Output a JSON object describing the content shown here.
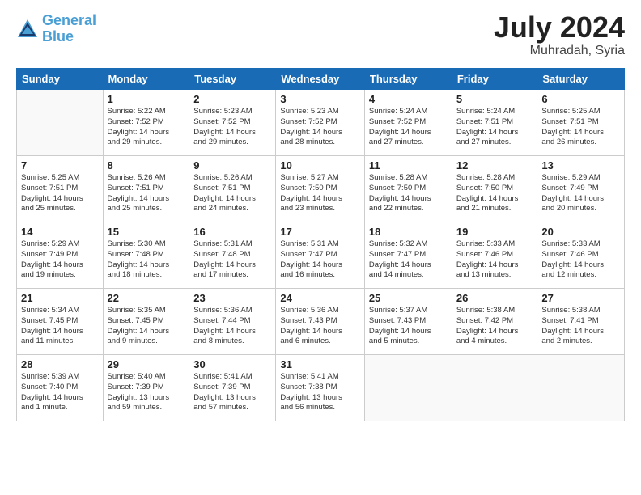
{
  "header": {
    "logo_line1": "General",
    "logo_line2": "Blue",
    "month": "July 2024",
    "location": "Muhradah, Syria"
  },
  "weekdays": [
    "Sunday",
    "Monday",
    "Tuesday",
    "Wednesday",
    "Thursday",
    "Friday",
    "Saturday"
  ],
  "weeks": [
    [
      {
        "day": "",
        "info": ""
      },
      {
        "day": "1",
        "info": "Sunrise: 5:22 AM\nSunset: 7:52 PM\nDaylight: 14 hours\nand 29 minutes."
      },
      {
        "day": "2",
        "info": "Sunrise: 5:23 AM\nSunset: 7:52 PM\nDaylight: 14 hours\nand 29 minutes."
      },
      {
        "day": "3",
        "info": "Sunrise: 5:23 AM\nSunset: 7:52 PM\nDaylight: 14 hours\nand 28 minutes."
      },
      {
        "day": "4",
        "info": "Sunrise: 5:24 AM\nSunset: 7:52 PM\nDaylight: 14 hours\nand 27 minutes."
      },
      {
        "day": "5",
        "info": "Sunrise: 5:24 AM\nSunset: 7:51 PM\nDaylight: 14 hours\nand 27 minutes."
      },
      {
        "day": "6",
        "info": "Sunrise: 5:25 AM\nSunset: 7:51 PM\nDaylight: 14 hours\nand 26 minutes."
      }
    ],
    [
      {
        "day": "7",
        "info": "Sunrise: 5:25 AM\nSunset: 7:51 PM\nDaylight: 14 hours\nand 25 minutes."
      },
      {
        "day": "8",
        "info": "Sunrise: 5:26 AM\nSunset: 7:51 PM\nDaylight: 14 hours\nand 25 minutes."
      },
      {
        "day": "9",
        "info": "Sunrise: 5:26 AM\nSunset: 7:51 PM\nDaylight: 14 hours\nand 24 minutes."
      },
      {
        "day": "10",
        "info": "Sunrise: 5:27 AM\nSunset: 7:50 PM\nDaylight: 14 hours\nand 23 minutes."
      },
      {
        "day": "11",
        "info": "Sunrise: 5:28 AM\nSunset: 7:50 PM\nDaylight: 14 hours\nand 22 minutes."
      },
      {
        "day": "12",
        "info": "Sunrise: 5:28 AM\nSunset: 7:50 PM\nDaylight: 14 hours\nand 21 minutes."
      },
      {
        "day": "13",
        "info": "Sunrise: 5:29 AM\nSunset: 7:49 PM\nDaylight: 14 hours\nand 20 minutes."
      }
    ],
    [
      {
        "day": "14",
        "info": "Sunrise: 5:29 AM\nSunset: 7:49 PM\nDaylight: 14 hours\nand 19 minutes."
      },
      {
        "day": "15",
        "info": "Sunrise: 5:30 AM\nSunset: 7:48 PM\nDaylight: 14 hours\nand 18 minutes."
      },
      {
        "day": "16",
        "info": "Sunrise: 5:31 AM\nSunset: 7:48 PM\nDaylight: 14 hours\nand 17 minutes."
      },
      {
        "day": "17",
        "info": "Sunrise: 5:31 AM\nSunset: 7:47 PM\nDaylight: 14 hours\nand 16 minutes."
      },
      {
        "day": "18",
        "info": "Sunrise: 5:32 AM\nSunset: 7:47 PM\nDaylight: 14 hours\nand 14 minutes."
      },
      {
        "day": "19",
        "info": "Sunrise: 5:33 AM\nSunset: 7:46 PM\nDaylight: 14 hours\nand 13 minutes."
      },
      {
        "day": "20",
        "info": "Sunrise: 5:33 AM\nSunset: 7:46 PM\nDaylight: 14 hours\nand 12 minutes."
      }
    ],
    [
      {
        "day": "21",
        "info": "Sunrise: 5:34 AM\nSunset: 7:45 PM\nDaylight: 14 hours\nand 11 minutes."
      },
      {
        "day": "22",
        "info": "Sunrise: 5:35 AM\nSunset: 7:45 PM\nDaylight: 14 hours\nand 9 minutes."
      },
      {
        "day": "23",
        "info": "Sunrise: 5:36 AM\nSunset: 7:44 PM\nDaylight: 14 hours\nand 8 minutes."
      },
      {
        "day": "24",
        "info": "Sunrise: 5:36 AM\nSunset: 7:43 PM\nDaylight: 14 hours\nand 6 minutes."
      },
      {
        "day": "25",
        "info": "Sunrise: 5:37 AM\nSunset: 7:43 PM\nDaylight: 14 hours\nand 5 minutes."
      },
      {
        "day": "26",
        "info": "Sunrise: 5:38 AM\nSunset: 7:42 PM\nDaylight: 14 hours\nand 4 minutes."
      },
      {
        "day": "27",
        "info": "Sunrise: 5:38 AM\nSunset: 7:41 PM\nDaylight: 14 hours\nand 2 minutes."
      }
    ],
    [
      {
        "day": "28",
        "info": "Sunrise: 5:39 AM\nSunset: 7:40 PM\nDaylight: 14 hours\nand 1 minute."
      },
      {
        "day": "29",
        "info": "Sunrise: 5:40 AM\nSunset: 7:39 PM\nDaylight: 13 hours\nand 59 minutes."
      },
      {
        "day": "30",
        "info": "Sunrise: 5:41 AM\nSunset: 7:39 PM\nDaylight: 13 hours\nand 57 minutes."
      },
      {
        "day": "31",
        "info": "Sunrise: 5:41 AM\nSunset: 7:38 PM\nDaylight: 13 hours\nand 56 minutes."
      },
      {
        "day": "",
        "info": ""
      },
      {
        "day": "",
        "info": ""
      },
      {
        "day": "",
        "info": ""
      }
    ]
  ]
}
